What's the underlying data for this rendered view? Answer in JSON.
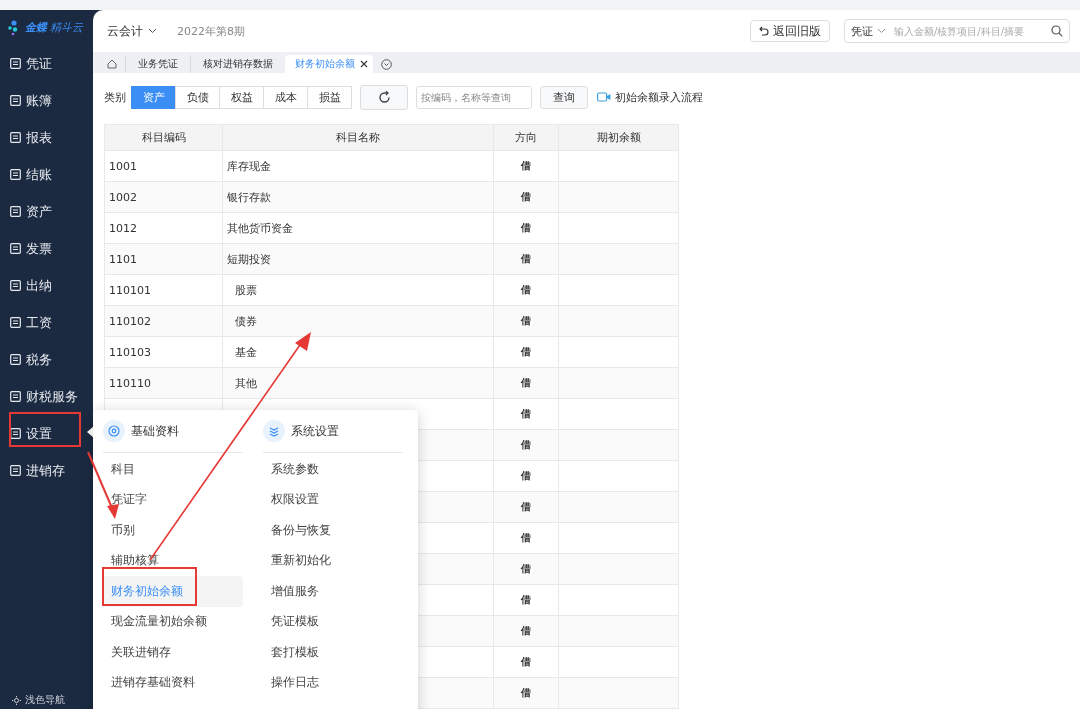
{
  "sidebar": {
    "logo": {
      "brand": "金蝶",
      "product": "精斗云"
    },
    "items": [
      {
        "label": "凭证"
      },
      {
        "label": "账簿"
      },
      {
        "label": "报表"
      },
      {
        "label": "结账"
      },
      {
        "label": "资产"
      },
      {
        "label": "发票"
      },
      {
        "label": "出纳"
      },
      {
        "label": "工资"
      },
      {
        "label": "税务"
      },
      {
        "label": "财税服务"
      },
      {
        "label": "设置"
      },
      {
        "label": "进销存"
      }
    ],
    "footer": "浅色导航"
  },
  "header": {
    "app_switch": "云会计",
    "period": "2022年第8期",
    "back_button": "返回旧版",
    "search": {
      "scope": "凭证",
      "placeholder": "输入金额/核算项目/科目/摘要"
    }
  },
  "tabs": [
    {
      "label": "业务凭证",
      "selected": false
    },
    {
      "label": "核对进销存数据",
      "selected": false
    },
    {
      "label": "财务初始余额",
      "selected": true
    }
  ],
  "toolbar": {
    "category_label": "类别",
    "categories": [
      {
        "label": "资产",
        "selected": true
      },
      {
        "label": "负债",
        "selected": false
      },
      {
        "label": "权益",
        "selected": false
      },
      {
        "label": "成本",
        "selected": false
      },
      {
        "label": "损益",
        "selected": false
      }
    ],
    "search_placeholder": "按编码，名称等查询",
    "query_button": "查询",
    "guide_link": "初始余额录入流程"
  },
  "table": {
    "columns": [
      "科目编码",
      "科目名称",
      "方向",
      "期初余额"
    ],
    "rows": [
      {
        "code": "1001",
        "name": "库存现金",
        "direction": "借"
      },
      {
        "code": "1002",
        "name": "银行存款",
        "direction": "借"
      },
      {
        "code": "1012",
        "name": "其他货币资金",
        "direction": "借"
      },
      {
        "code": "1101",
        "name": "短期投资",
        "direction": "借",
        "children": [
          {
            "code": "110101",
            "name": "股票",
            "direction": "借"
          },
          {
            "code": "110102",
            "name": "债券",
            "direction": "借"
          },
          {
            "code": "110103",
            "name": "基金",
            "direction": "借"
          },
          {
            "code": "110110",
            "name": "其他",
            "direction": "借"
          }
        ]
      },
      {
        "direction": "借"
      },
      {
        "direction": "借"
      },
      {
        "direction": "借"
      },
      {
        "direction": "借"
      },
      {
        "direction": "借"
      },
      {
        "direction": "借"
      },
      {
        "direction": "借"
      },
      {
        "direction": "借"
      },
      {
        "direction": "借"
      },
      {
        "direction": "借"
      }
    ]
  },
  "settings_menu": {
    "sections": [
      {
        "title": "基础资料",
        "items": [
          {
            "label": "科目",
            "selected": false
          },
          {
            "label": "凭证字",
            "selected": false
          },
          {
            "label": "币别",
            "selected": false
          },
          {
            "label": "辅助核算",
            "selected": false
          },
          {
            "label": "财务初始余额",
            "selected": true
          },
          {
            "label": "现金流量初始余额",
            "selected": false
          },
          {
            "label": "关联进销存",
            "selected": false
          },
          {
            "label": "进销存基础资料",
            "selected": false
          }
        ]
      },
      {
        "title": "系统设置",
        "items": [
          {
            "label": "系统参数",
            "selected": false
          },
          {
            "label": "权限设置",
            "selected": false
          },
          {
            "label": "备份与恢复",
            "selected": false
          },
          {
            "label": "重新初始化",
            "selected": false
          },
          {
            "label": "增值服务",
            "selected": false
          },
          {
            "label": "凭证模板",
            "selected": false
          },
          {
            "label": "套打模板",
            "selected": false
          },
          {
            "label": "操作日志",
            "selected": false
          }
        ]
      }
    ]
  }
}
